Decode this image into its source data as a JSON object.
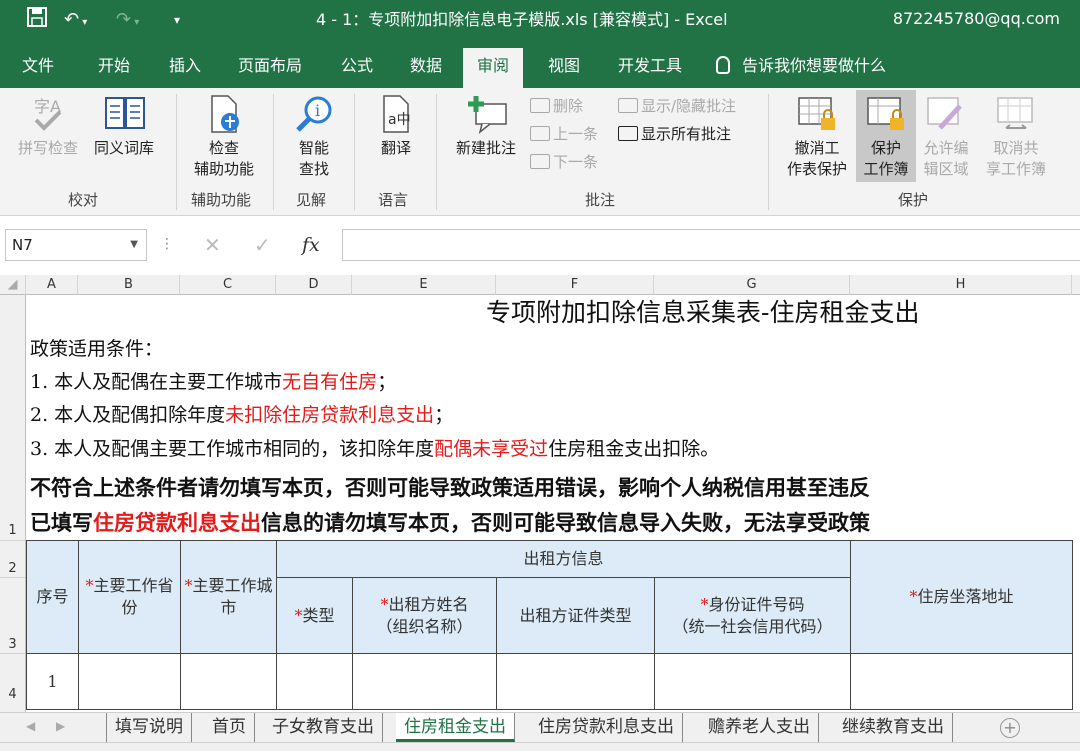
{
  "titlebar": {
    "title": "4 - 1：专项附加扣除信息电子模版.xls  [兼容模式]  -  Excel",
    "user": "872245780@qq.com"
  },
  "menu": {
    "tabs": [
      "文件",
      "开始",
      "插入",
      "页面布局",
      "公式",
      "数据",
      "审阅",
      "视图",
      "开发工具"
    ],
    "active_tab": "审阅",
    "tell_me": "告诉我你想要做什么"
  },
  "ribbon": {
    "spell_check": "拼写检查",
    "thesaurus": "同义词库",
    "check_line1": "检查",
    "check_line2": "辅助功能",
    "smart_line1": "智能",
    "smart_line2": "查找",
    "translate": "翻译",
    "new_comment": "新建批注",
    "delete": "删除",
    "previous": "上一条",
    "next": "下一条",
    "show_hide_comment": "显示/隐藏批注",
    "show_all_comments": "显示所有批注",
    "unprotect_line1": "撤消工",
    "unprotect_line2": "作表保护",
    "protect_line1": "保护",
    "protect_line2": "工作簿",
    "allow_edit_line1": "允许编",
    "allow_edit_line2": "辑区域",
    "unshare_line1": "取消共",
    "unshare_line2": "享工作簿",
    "groups": {
      "proofing": "校对",
      "accessibility": "辅助功能",
      "insights": "见解",
      "language": "语言",
      "comments": "批注",
      "protect": "保护"
    }
  },
  "formula_bar": {
    "name_box": "N7",
    "fx": "fx",
    "cancel": "✕",
    "enter": "✓",
    "formula": ""
  },
  "columns": [
    "A",
    "B",
    "C",
    "D",
    "E",
    "F",
    "G",
    "H"
  ],
  "rows": [
    "1",
    "2",
    "3",
    "4"
  ],
  "sheet": {
    "form_title": "专项附加扣除信息采集表-住房租金支出",
    "policy_heading": "政策适用条件：",
    "cond1_a": "1. 本人及配偶在主要工作城市",
    "cond1_red": "无自有住房",
    "cond1_b": "；",
    "cond2_a": "2. 本人及配偶扣除年度",
    "cond2_red": "未扣除住房贷款利息支出",
    "cond2_b": "；",
    "cond3_a": "3. 本人及配偶主要工作城市相同的，该扣除年度",
    "cond3_red": "配偶未享受过",
    "cond3_b": "住房租金支出扣除。",
    "warn1": "不符合上述条件者请勿填写本页，否则可能导致政策适用错误，影响个人纳税信用甚至违反",
    "warn2_a": "已填写",
    "warn2_red": "住房贷款利息支出",
    "warn2_b": "信息的请勿填写本页，否则可能导致信息导入失败，无法享受政策"
  },
  "table": {
    "star": "*",
    "seq": "序号",
    "province": "主要工作省份",
    "city": "主要工作城市",
    "lessor_info": "出租方信息",
    "type": "类型",
    "lessor_name_1": "出租方姓名",
    "lessor_name_2": "（组织名称）",
    "lessor_id_type": "出租方证件类型",
    "id_no_1": "身份证件号码",
    "id_no_2": "（统一社会信用代码）",
    "address": "住房坐落地址",
    "row1": "1"
  },
  "sheet_tabs": [
    "填写说明",
    "首页",
    "子女教育支出",
    "住房租金支出",
    "住房贷款利息支出",
    "赡养老人支出",
    "继续教育支出"
  ],
  "active_sheet": "住房租金支出",
  "colors": {
    "excel_green": "#217346",
    "header_fill": "#dcebf7",
    "emphasis_red": "#e31b1b"
  }
}
